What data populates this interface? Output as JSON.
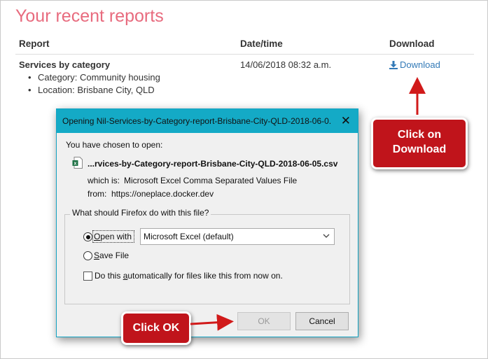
{
  "page": {
    "title": "Your recent reports",
    "columns": [
      "Report",
      "Date/time",
      "Download"
    ],
    "report": {
      "name": "Services by category",
      "details": [
        "Category: Community housing",
        "Location: Brisbane City, QLD"
      ],
      "datetime": "14/06/2018 08:32 a.m.",
      "download_label": "Download"
    }
  },
  "dialog": {
    "title": "Opening Nil-Services-by-Category-report-Brisbane-City-QLD-2018-06-0...",
    "chosen_label": "You have chosen to open:",
    "file_name": "...rvices-by-Category-report-Brisbane-City-QLD-2018-06-05.csv",
    "which_is_label": "which is:",
    "which_is_value": "Microsoft Excel Comma Separated Values File",
    "from_label": "from:",
    "from_value": "https://oneplace.docker.dev",
    "group_label": "What should Firefox do with this file?",
    "open_with_label": "Open with",
    "open_with_value": "Microsoft Excel (default)",
    "save_file_label": "Save File",
    "auto_label": "Do this automatically for files like this from now on.",
    "ok_label": "OK",
    "cancel_label": "Cancel",
    "open_with_checked": true,
    "auto_checked": false
  },
  "annotations": {
    "click_download_line1": "Click on",
    "click_download_line2": "Download",
    "click_ok": "Click OK"
  },
  "colors": {
    "title": "#e86b7e",
    "link": "#337ab7",
    "dialog_titlebar": "#14aac6",
    "callout": "#c0141b",
    "arrow": "#d11a1a"
  },
  "icons": {
    "download": "download-icon",
    "file": "excel-file-icon",
    "close": "close-icon",
    "dropdown": "chevron-down-icon"
  }
}
